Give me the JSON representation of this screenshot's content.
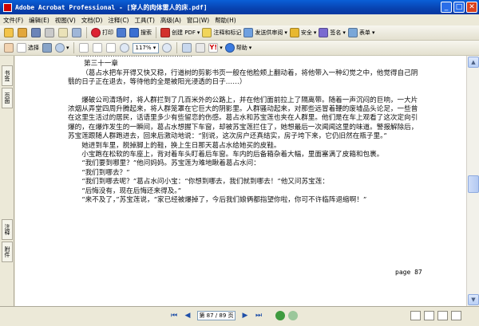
{
  "window": {
    "title": "Adobe Acrobat Professional - [穿人的肉体雷人的床.pdf]",
    "controls": [
      "minimize",
      "maximize",
      "close"
    ]
  },
  "menu": [
    "文件(F)",
    "编辑(E)",
    "视图(V)",
    "文档(D)",
    "注释(C)",
    "工具(T)",
    "高级(A)",
    "窗口(W)",
    "帮助(H)"
  ],
  "toolbar1": {
    "print_label": "打印",
    "search_label": "搜索",
    "create_pdf_label": "创建 PDF",
    "comment_label": "注释和标记",
    "send_label": "发送供审阅",
    "secure_label": "安全",
    "sign_label": "签名",
    "forms_label": "表单"
  },
  "toolbar2": {
    "select_label": "选择",
    "zoom_value": "117%",
    "help_label": "帮助"
  },
  "leftnav": {
    "tab1": "书签",
    "tab2": "页面",
    "tab3": "注释",
    "tab4": "附件"
  },
  "document": {
    "top_fragment": "……………………………………………",
    "chapter": "第三十一章",
    "para1": "（葛占水把车开得又快又稳，行道树的剪影书页一般在他脸颊上翻动着，将他带入一种幻觉之中，他觉得自己阴翳的日子正在退去，等待他的全是被阳光浸透的日子……）",
    "para2": "爆破公司清场时，将人群拦到了几百米外的公路上，并在他们面前拉上了隔离带。随着一声沉闷的巨响，一大片浓烟从弄堂四周升腾起来，将人群笼罩在它巨大的阴影里。人群骚动起来，对那些远冒着鞭的废墟品头论足，一些曾在这里生活过的居民，话语里多少有些留恋的伤感。葛占水和苏宝莲也夹在人群里。他们是在车上观看了这次定向引爆的，在爆炸发生的一瞬间，葛占水想握下车窗，却被苏宝莲拦住了，她想最后一次闻闻这里的味道。警报解除后，苏宝莲跟随人群跑进去，回来后激动地说：“别说，这次房户还真结实，房子垮下来，它仍旧然在瓶子里。”",
    "para3": "她进到车里，脱掉脚上的鞋，换上生日那天葛占水给她买的皮鞋。",
    "para4": "小宝跑在松软的车座上，背对着车头盯着后车窗。车内的后备箱杂着大幅，里面塞满了皮箱和包裹。",
    "line5": "“我们要到哪里？”他问妈妈。苏宝莲为难地瞅着葛占水问：",
    "line6": "“我们到哪去？”",
    "line7": "“我们到哪去呢？”葛占水问小宝：“你想到哪去，我们就到哪去！”他又问苏宝莲：",
    "line8": "“后悔没有，现在后悔还来得及。”",
    "line9": "“来不及了，”苏宝莲说，“家已经被爆掉了，今后我们娘俩都指望你啦，你可不许临阵退缩啊！”",
    "page_number": "page 87"
  },
  "statusbar": {
    "page_indicator": "第 87 / 89 页"
  }
}
